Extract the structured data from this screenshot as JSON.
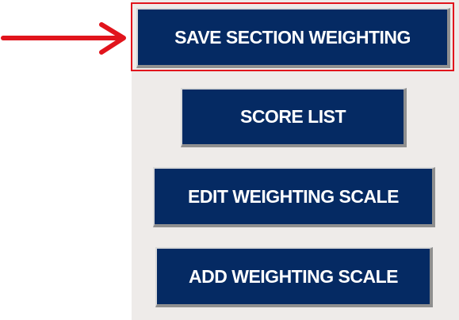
{
  "buttons": {
    "save_section_weighting": "SAVE SECTION WEIGHTING",
    "score_list": "SCORE LIST",
    "edit_weighting_scale": "EDIT WEIGHTING SCALE",
    "add_weighting_scale": "ADD WEIGHTING SCALE"
  },
  "annotation": {
    "arrow_icon": "arrow-right-icon",
    "arrow_color": "#e1141c",
    "highlight_color": "#e1141c"
  },
  "colors": {
    "button_bg": "#052a63",
    "button_text": "#ffffff",
    "panel_bg": "#eeebe9"
  }
}
